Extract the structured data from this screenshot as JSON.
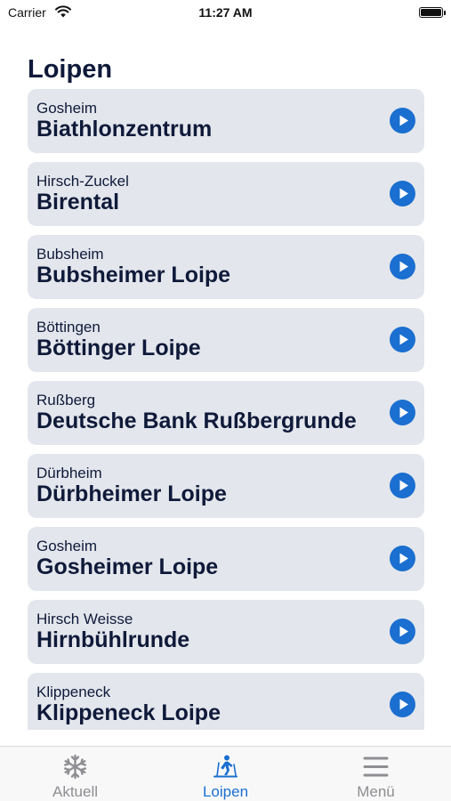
{
  "status_bar": {
    "carrier": "Carrier",
    "time": "11:27 AM",
    "battery_level": 1.0
  },
  "page": {
    "title": "Loipen"
  },
  "trails": [
    {
      "region": "Gosheim",
      "name": "Biathlonzentrum"
    },
    {
      "region": "Hirsch-Zuckel",
      "name": "Birental"
    },
    {
      "region": "Bubsheim",
      "name": "Bubsheimer Loipe"
    },
    {
      "region": "Böttingen",
      "name": "Böttinger Loipe"
    },
    {
      "region": "Rußberg",
      "name": "Deutsche Bank Rußbergrunde"
    },
    {
      "region": "Dürbheim",
      "name": "Dürbheimer Loipe"
    },
    {
      "region": "Gosheim",
      "name": "Gosheimer Loipe"
    },
    {
      "region": "Hirsch Weisse",
      "name": "Hirnbühlrunde"
    },
    {
      "region": "Klippeneck",
      "name": "Klippeneck Loipe"
    }
  ],
  "tab_bar": {
    "tabs": [
      {
        "label": "Aktuell",
        "icon": "snowflake-icon",
        "active": false
      },
      {
        "label": "Loipen",
        "icon": "skier-icon",
        "active": true
      },
      {
        "label": "Menü",
        "icon": "menu-icon",
        "active": false
      }
    ]
  },
  "colors": {
    "accent": "#1a6fd0",
    "card_bg": "#e3e6ec",
    "text": "#0f1a3a",
    "inactive": "#8e8e93"
  }
}
